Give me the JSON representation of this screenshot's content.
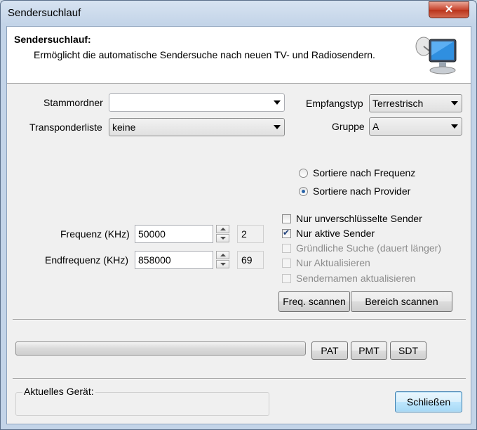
{
  "window": {
    "title": "Sendersuchlauf",
    "close_glyph": "✕"
  },
  "header": {
    "title": "Sendersuchlauf:",
    "description": "Ermöglicht die automatische Sendersuche nach neuen TV- und Radiosendern.",
    "icon": "monitor-satellite-icon"
  },
  "form": {
    "stammordner": {
      "label": "Stammordner",
      "value": ""
    },
    "transponderliste": {
      "label": "Transponderliste",
      "value": "keine"
    },
    "empfangstyp": {
      "label": "Empfangstyp",
      "value": "Terrestrisch"
    },
    "gruppe": {
      "label": "Gruppe",
      "value": "A"
    }
  },
  "sort": {
    "frequenz": {
      "label": "Sortiere nach Frequenz",
      "selected": false
    },
    "provider": {
      "label": "Sortiere nach Provider",
      "selected": true
    }
  },
  "frequency": {
    "start_label": "Frequenz (KHz)",
    "start_value": "50000",
    "start_channel": "2",
    "end_label": "Endfrequenz (KHz)",
    "end_value": "858000",
    "end_channel": "69"
  },
  "options": [
    {
      "label": "Nur unverschlüsselte Sender",
      "checked": false,
      "enabled": true
    },
    {
      "label": "Nur aktive Sender",
      "checked": true,
      "enabled": true
    },
    {
      "label": "Gründliche Suche (dauert länger)",
      "checked": false,
      "enabled": false
    },
    {
      "label": "Nur Aktualisieren",
      "checked": false,
      "enabled": false
    },
    {
      "label": "Sendernamen aktualisieren",
      "checked": false,
      "enabled": false
    }
  ],
  "buttons": {
    "freq_scan": "Freq. scannen",
    "range_scan": "Bereich scannen",
    "pat": "PAT",
    "pmt": "PMT",
    "sdt": "SDT",
    "close": "Schließen"
  },
  "progress": {
    "fraction": 0.0
  },
  "device": {
    "label": "Aktuelles Gerät:",
    "value": ""
  }
}
